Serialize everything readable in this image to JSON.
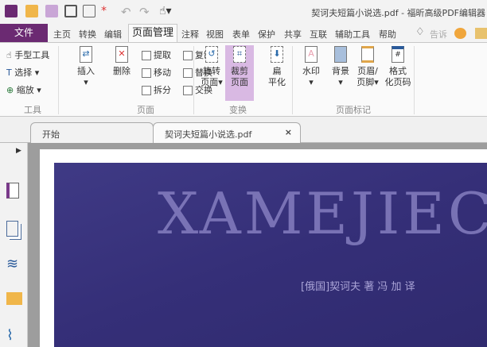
{
  "window": {
    "title": "契诃夫短篇小说选.pdf - 福昕高级PDF编辑器"
  },
  "menu": {
    "file": "文件",
    "items": [
      "主页",
      "转换",
      "编辑",
      "页面管理",
      "注释",
      "视图",
      "表单",
      "保护",
      "共享",
      "互联",
      "辅助工具",
      "帮助"
    ],
    "active": "页面管理",
    "tell": "告诉"
  },
  "ribbon": {
    "tools": {
      "hand": "手型工具",
      "select": "选择",
      "zoom": "缩放",
      "label": "工具"
    },
    "page": {
      "insert": "插入",
      "delete": "删除",
      "extract": "提取",
      "move": "移动",
      "split": "拆分",
      "copy": "复制",
      "replace": "替换",
      "swap": "交换",
      "label": "页面"
    },
    "transform": {
      "rotate1": "旋转",
      "rotate2": "页面",
      "crop1": "裁剪",
      "crop2": "页面",
      "flat1": "扁",
      "flat2": "平化",
      "label": "变换"
    },
    "marks": {
      "watermark": "水印",
      "background": "背景",
      "header1": "页眉/",
      "header2": "页脚",
      "pagenum1": "格式",
      "pagenum2": "化页码",
      "label": "页面标记"
    }
  },
  "tabs": [
    {
      "label": "开始"
    },
    {
      "label": "契诃夫短篇小说选.pdf",
      "close": "×"
    }
  ],
  "document": {
    "cover_title": "XAMEJIEC",
    "cover_author": "[俄国]契诃夫 著 冯 加 译"
  },
  "colors": {
    "accent": "#6b2a72",
    "crop_highlight": "#d9b9e3"
  }
}
